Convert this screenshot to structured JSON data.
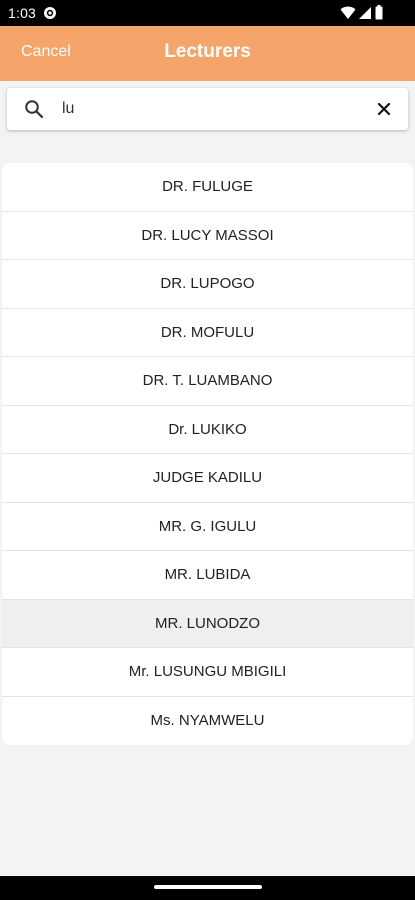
{
  "status_bar": {
    "time": "1:03"
  },
  "header": {
    "cancel_label": "Cancel",
    "title": "Lecturers",
    "background_color": "#f5a56a"
  },
  "search": {
    "value": "lu",
    "placeholder": ""
  },
  "lecturers": [
    {
      "name": "DR. FULUGE"
    },
    {
      "name": "DR. LUCY MASSOI"
    },
    {
      "name": "DR. LUPOGO"
    },
    {
      "name": "DR. MOFULU"
    },
    {
      "name": "DR. T. LUAMBANO"
    },
    {
      "name": "Dr. LUKIKO"
    },
    {
      "name": "JUDGE KADILU"
    },
    {
      "name": "MR. G. IGULU"
    },
    {
      "name": "MR. LUBIDA"
    },
    {
      "name": "MR. LUNODZO",
      "selected": true
    },
    {
      "name": "Mr. LUSUNGU MBIGILI"
    },
    {
      "name": "Ms. NYAMWELU"
    }
  ],
  "icons": {
    "status_app": "app-indicator-icon",
    "wifi": "wifi-icon",
    "signal": "cell-signal-icon",
    "battery": "battery-icon",
    "search": "search-icon",
    "clear": "close-icon"
  }
}
